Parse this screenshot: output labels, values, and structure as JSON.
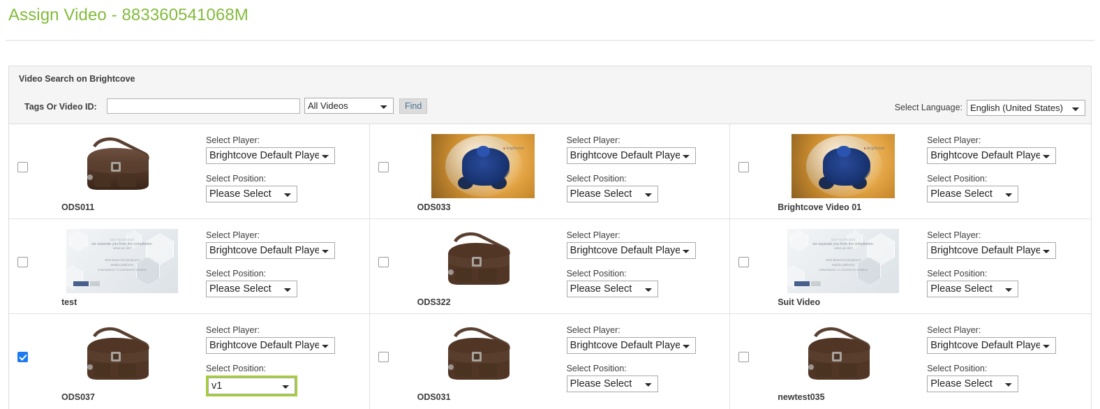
{
  "page": {
    "title": "Assign Video - 883360541068M",
    "title_color": "#83bb3c"
  },
  "search_panel": {
    "heading": "Video Search on Brightcove",
    "tags_label": "Tags Or Video ID:",
    "tags_value": "",
    "tags_placeholder": "",
    "scope_selected": "All Videos",
    "scope_options": [
      "All Videos"
    ],
    "find_label": "Find",
    "language_label": "Select Language:",
    "language_selected": "English (United States)",
    "language_options": [
      "English (United States)"
    ]
  },
  "labels": {
    "select_player": "Select Player:",
    "select_position": "Select Position:"
  },
  "options": {
    "player_default": "Brightcove Default Player",
    "position_default": "Please Select",
    "position_v1": "v1"
  },
  "highlight_color": "#a6ce39",
  "checkbox_checked_color": "#1c7ced",
  "videos": [
    {
      "name": "ODS011",
      "thumb": "bag-thumbnail",
      "checked": false,
      "player": "Brightcove Default Player",
      "position": "Please Select",
      "position_highlighted": false
    },
    {
      "name": "ODS033",
      "thumb": "quadbike-thumbnail",
      "checked": false,
      "player": "Brightcove Default Player",
      "position": "Please Select",
      "position_highlighted": false
    },
    {
      "name": "Brightcove Video 01",
      "thumb": "quadbike-thumbnail",
      "checked": false,
      "player": "Brightcove Default Player",
      "position": "Please Select",
      "position_highlighted": false
    },
    {
      "name": "test",
      "thumb": "promo-slide-thumbnail",
      "checked": false,
      "player": "Brightcove Default Player",
      "position": "Please Select",
      "position_highlighted": false
    },
    {
      "name": "ODS322",
      "thumb": "bag-thumbnail",
      "checked": false,
      "player": "Brightcove Default Player",
      "position": "Please Select",
      "position_highlighted": false
    },
    {
      "name": "Suit Video",
      "thumb": "promo-slide-thumbnail",
      "checked": false,
      "player": "Brightcove Default Player",
      "position": "Please Select",
      "position_highlighted": false
    },
    {
      "name": "ODS037",
      "thumb": "bag-thumbnail",
      "checked": true,
      "player": "Brightcove Default Player",
      "position": "v1",
      "position_highlighted": true
    },
    {
      "name": "ODS031",
      "thumb": "bag-thumbnail",
      "checked": false,
      "player": "Brightcove Default Player",
      "position": "Please Select",
      "position_highlighted": false
    },
    {
      "name": "newtest035",
      "thumb": "bag-thumbnail",
      "checked": false,
      "player": "Brightcove Default Player",
      "position": "Please Select",
      "position_highlighted": false
    }
  ],
  "promo_thumb_text": {
    "line1": "GET NOTICED!",
    "line2": "we separate you from the compilation.",
    "line3": "what we do?",
    "item1": "Web Based Development",
    "item2": "Mobile platforms",
    "item3": "e-Bussiness / e-Commerce Solution"
  },
  "quad_thumb_text": {
    "logo": "brightcove"
  }
}
